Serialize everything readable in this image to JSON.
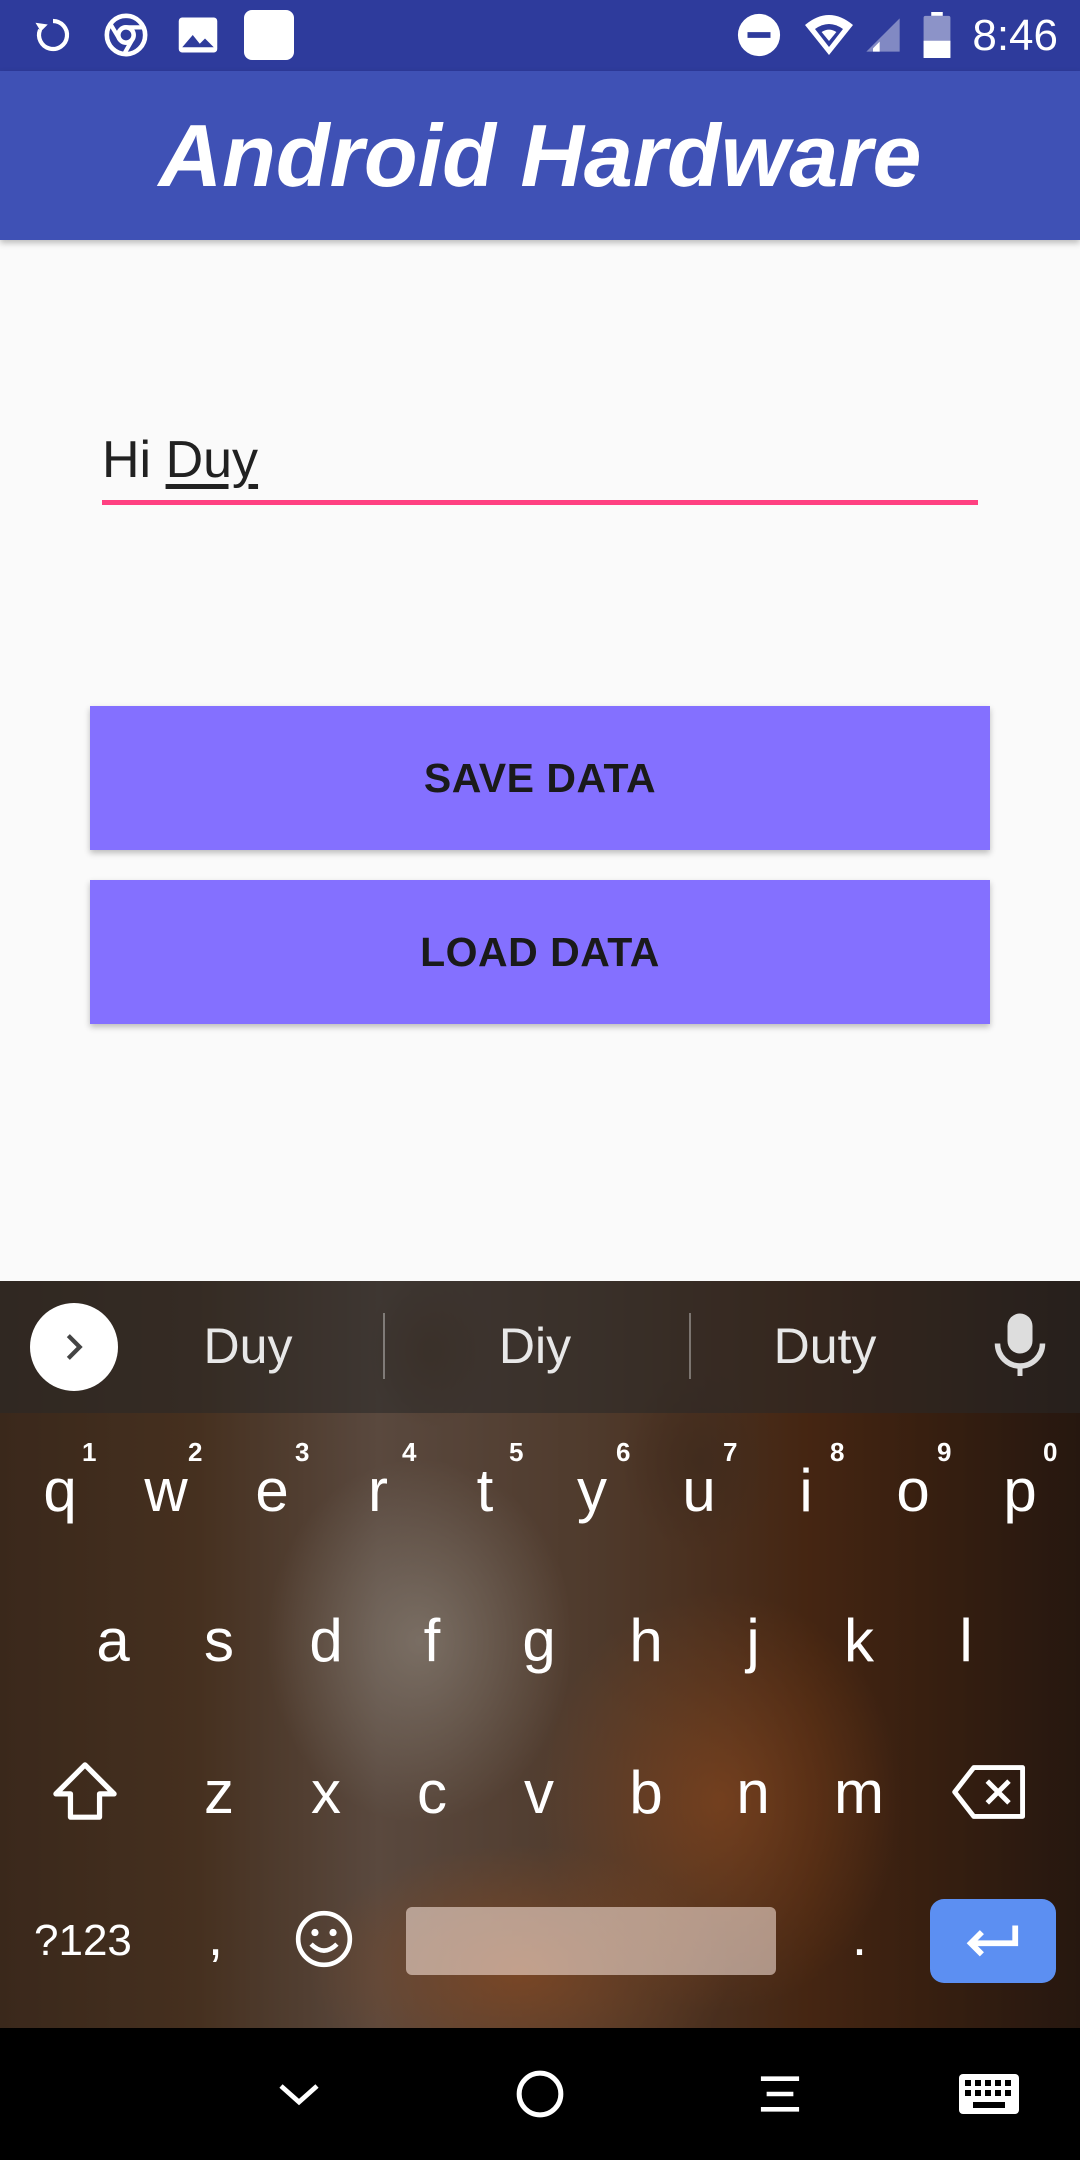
{
  "status_bar": {
    "time": "8:46",
    "left_icons": [
      "sync-icon",
      "chrome-icon",
      "image-icon",
      "app-icon"
    ],
    "right_icons": [
      "do-not-disturb-icon",
      "wifi-icon",
      "signal-icon",
      "battery-icon"
    ]
  },
  "app_bar": {
    "title": "Android Hardware",
    "color": "#3f51b5"
  },
  "edit_text": {
    "prefix": "Hi ",
    "composing": "Duy",
    "underline_color": "#ff4081"
  },
  "buttons": {
    "save": "SAVE DATA",
    "load": "LOAD DATA",
    "color": "#8470ff"
  },
  "keyboard": {
    "suggestions": [
      "Duy",
      "Diy",
      "Duty"
    ],
    "rows": [
      [
        "q",
        "w",
        "e",
        "r",
        "t",
        "y",
        "u",
        "i",
        "o",
        "p"
      ],
      [
        "a",
        "s",
        "d",
        "f",
        "g",
        "h",
        "j",
        "k",
        "l"
      ],
      [
        "z",
        "x",
        "c",
        "v",
        "b",
        "n",
        "m"
      ]
    ],
    "numbers": [
      "1",
      "2",
      "3",
      "4",
      "5",
      "6",
      "7",
      "8",
      "9",
      "0"
    ],
    "symbols_label": "?123",
    "comma": ",",
    "period": ".",
    "enter_color": "#5c8ff2"
  },
  "nav_bar": {
    "buttons": [
      "hide-keyboard-icon",
      "home-icon",
      "recents-icon",
      "keyboard-icon"
    ]
  }
}
